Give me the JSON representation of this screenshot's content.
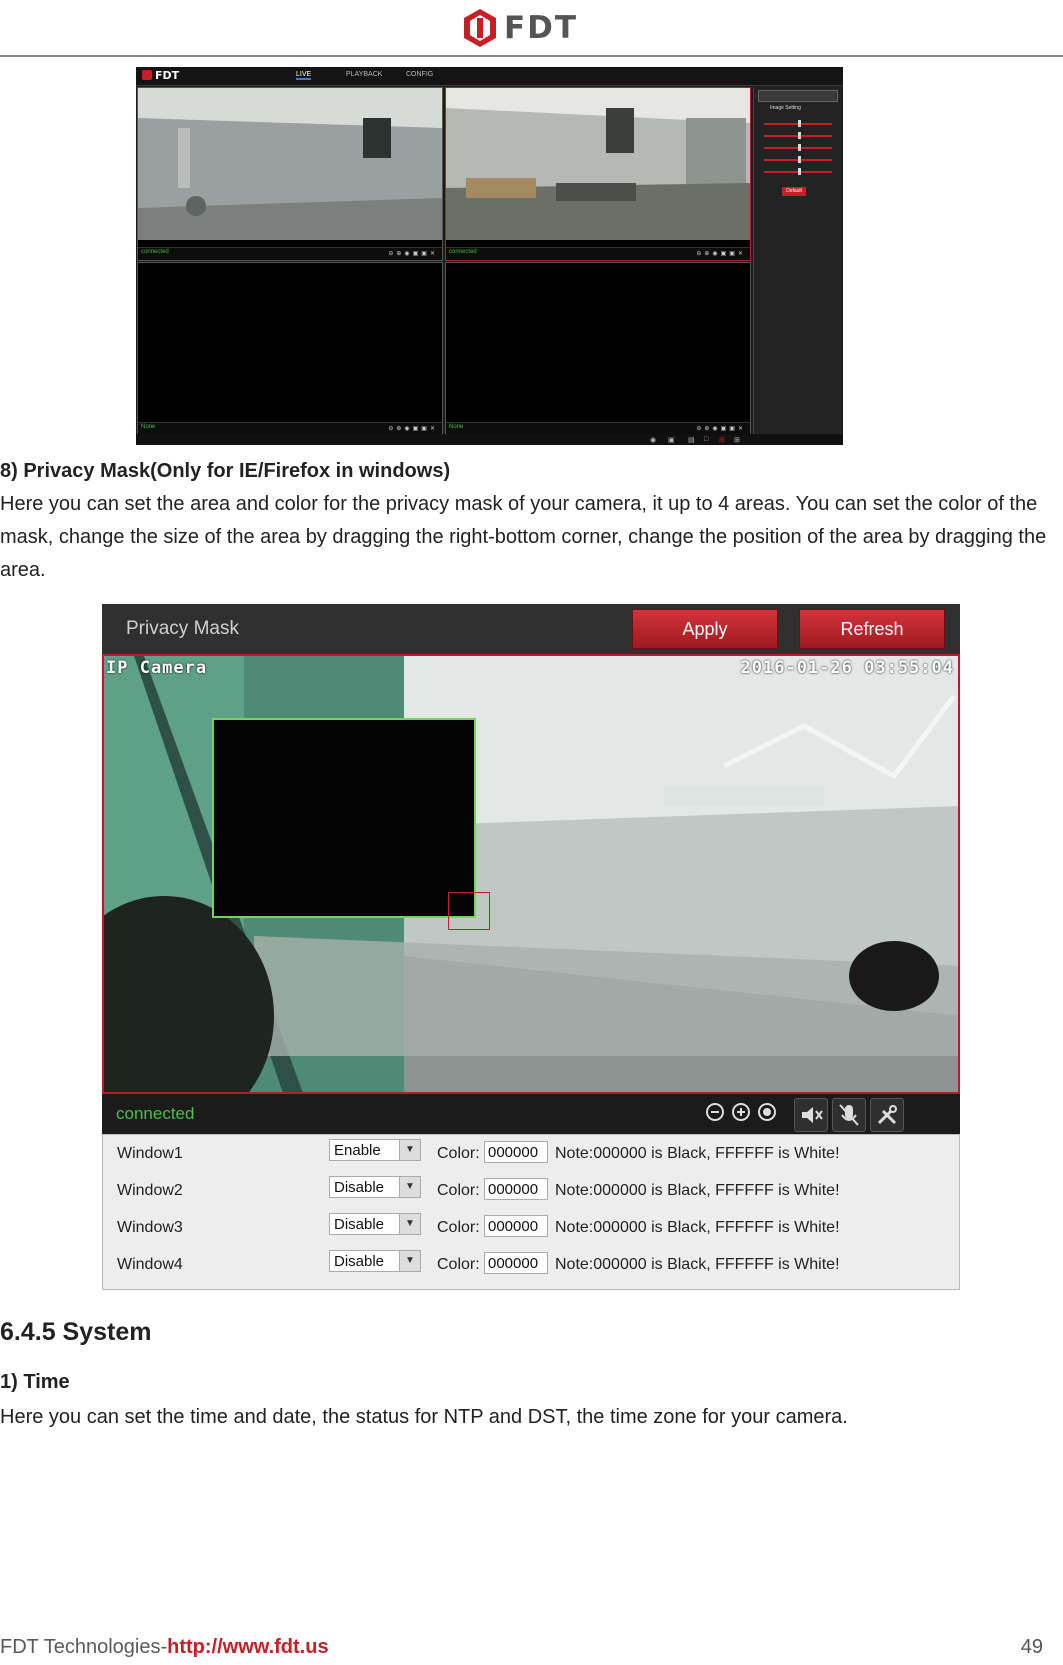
{
  "header": {
    "brand": "FDT",
    "logo_color": "#c62026"
  },
  "top_screenshot": {
    "brand": "FDT",
    "tabs": [
      "LIVE",
      "PLAYBACK",
      "CONFIG"
    ],
    "active_tab": "LIVE",
    "pane_labels": [
      "connected",
      "connected",
      "None",
      "None"
    ],
    "side_title": "Image Setting",
    "side_button": "Default"
  },
  "section8": {
    "title": "8) Privacy Mask(Only for IE/Firefox in windows)",
    "body": "Here you can set the area and color for the privacy mask of your camera, it up to 4 areas. You can set the color of the mask, change the size of the area by dragging the right-bottom corner, change the position of the area by dragging the area."
  },
  "privacy_mask": {
    "title": "Privacy Mask",
    "apply_label": "Apply",
    "refresh_label": "Refresh",
    "camera_label": "IP Camera",
    "timestamp": "2016-01-26 03:55:04",
    "status": "connected",
    "color_label": "Color:",
    "windows": [
      {
        "name": "Window1",
        "state": "Enable",
        "color": "000000",
        "note": "Note:000000 is Black, FFFFFF is White!"
      },
      {
        "name": "Window2",
        "state": "Disable",
        "color": "000000",
        "note": "Note:000000 is Black, FFFFFF is White!"
      },
      {
        "name": "Window3",
        "state": "Disable",
        "color": "000000",
        "note": "Note:000000 is Black, FFFFFF is White!"
      },
      {
        "name": "Window4",
        "state": "Disable",
        "color": "000000",
        "note": "Note:000000 is Black, FFFFFF is White!"
      }
    ],
    "mask_color": "#000000",
    "mask_border_color": "#74d45d",
    "accent_color": "#b22026"
  },
  "system": {
    "section_title": "6.4.5 System",
    "time_title": "1) Time",
    "time_body": "Here you can set the time and date, the status for NTP and DST, the time zone for your camera."
  },
  "footer": {
    "company": "FDT Technologies-",
    "url": "http://www.fdt.us",
    "page_number": "49"
  }
}
